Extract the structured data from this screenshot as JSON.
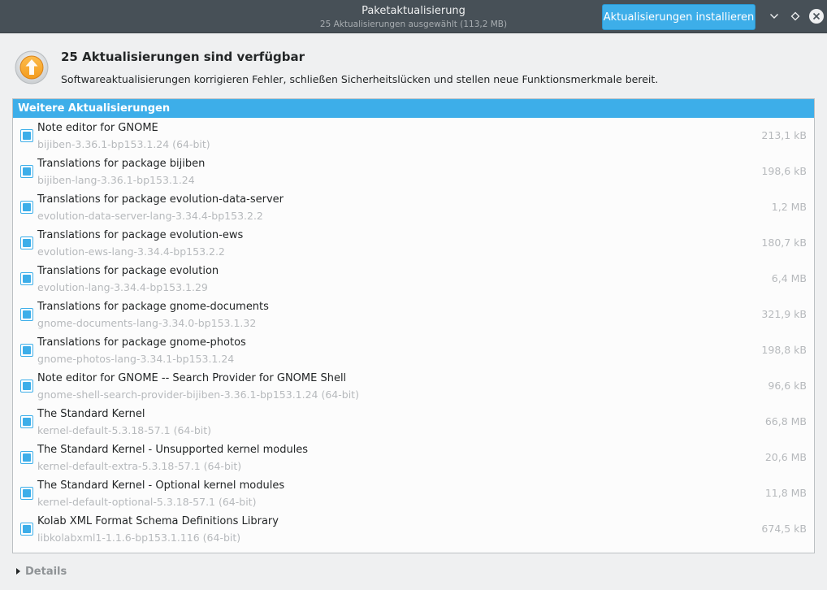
{
  "window": {
    "title": "Paketaktualisierung",
    "subtitle": "25 Aktualisierungen ausgewählt (113,2 MB)",
    "install_button": "Aktualisierungen installieren",
    "controls": [
      "chevron-down-icon",
      "diamond-icon",
      "close-icon"
    ]
  },
  "header": {
    "icon": "update-arrow-icon",
    "title": "25 Aktualisierungen sind verfügbar",
    "description": "Softwareaktualisierungen korrigieren Fehler, schließen Sicherheitslücken und stellen neue Funktionsmerkmale bereit."
  },
  "list": {
    "section_title": "Weitere Aktualisierungen",
    "items": [
      {
        "summary": "Note editor for GNOME",
        "package": "bijiben-3.36.1-bp153.1.24 (64-bit)",
        "size": "213,1 kB",
        "checked": true
      },
      {
        "summary": "Translations for package bijiben",
        "package": "bijiben-lang-3.36.1-bp153.1.24",
        "size": "198,6 kB",
        "checked": true
      },
      {
        "summary": "Translations for package evolution-data-server",
        "package": "evolution-data-server-lang-3.34.4-bp153.2.2",
        "size": "1,2 MB",
        "checked": true
      },
      {
        "summary": "Translations for package evolution-ews",
        "package": "evolution-ews-lang-3.34.4-bp153.2.2",
        "size": "180,7 kB",
        "checked": true
      },
      {
        "summary": "Translations for package evolution",
        "package": "evolution-lang-3.34.4-bp153.1.29",
        "size": "6,4 MB",
        "checked": true
      },
      {
        "summary": "Translations for package gnome-documents",
        "package": "gnome-documents-lang-3.34.0-bp153.1.32",
        "size": "321,9 kB",
        "checked": true
      },
      {
        "summary": "Translations for package gnome-photos",
        "package": "gnome-photos-lang-3.34.1-bp153.1.24",
        "size": "198,8 kB",
        "checked": true
      },
      {
        "summary": "Note editor for GNOME -- Search Provider for GNOME Shell",
        "package": "gnome-shell-search-provider-bijiben-3.36.1-bp153.1.24 (64-bit)",
        "size": "96,6 kB",
        "checked": true
      },
      {
        "summary": "The Standard Kernel",
        "package": "kernel-default-5.3.18-57.1 (64-bit)",
        "size": "66,8 MB",
        "checked": true
      },
      {
        "summary": "The Standard Kernel - Unsupported kernel modules",
        "package": "kernel-default-extra-5.3.18-57.1 (64-bit)",
        "size": "20,6 MB",
        "checked": true
      },
      {
        "summary": "The Standard Kernel - Optional kernel modules",
        "package": "kernel-default-optional-5.3.18-57.1 (64-bit)",
        "size": "11,8 MB",
        "checked": true
      },
      {
        "summary": "Kolab XML Format Schema Definitions Library",
        "package": "libkolabxml1-1.1.6-bp153.1.116 (64-bit)",
        "size": "674,5 kB",
        "checked": true
      }
    ]
  },
  "footer": {
    "details_label": "Details"
  },
  "colors": {
    "accent": "#3daee9",
    "titlebar": "#475057",
    "background": "#eff0f1",
    "muted_text": "#b6b9bc"
  }
}
